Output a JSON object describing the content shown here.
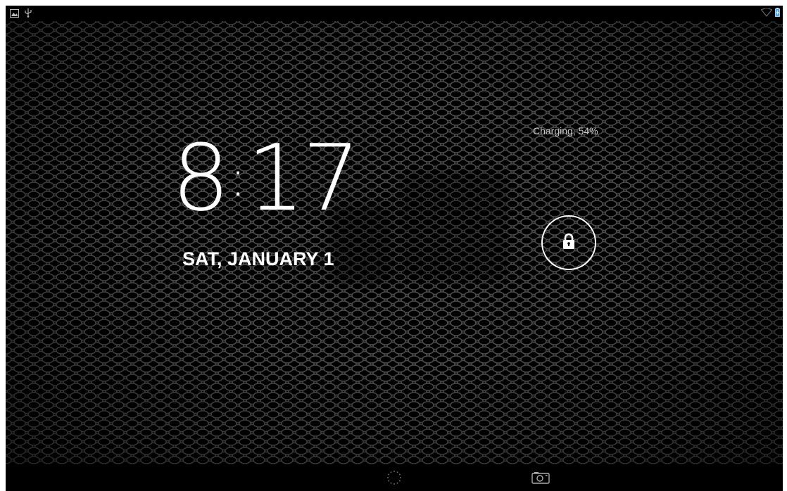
{
  "status_bar": {
    "left_icons": [
      "image-notification-icon",
      "usb-icon"
    ],
    "right_icons": [
      "wifi-icon",
      "battery-charging-icon"
    ]
  },
  "lockscreen": {
    "time": {
      "hours": "8",
      "separator": ":",
      "minutes": "17"
    },
    "date": "SAT, JANUARY 1",
    "charging_status": "Charging, 54%",
    "battery_percent": 54,
    "unlock_icon": "padlock-icon"
  },
  "nav_bar": {
    "items": [
      "google-now-ring-icon",
      "camera-icon"
    ]
  },
  "colors": {
    "background": "#000000",
    "mesh": "#3a3a3a",
    "text_primary": "#ffffff",
    "text_secondary": "#c8c8c8"
  }
}
